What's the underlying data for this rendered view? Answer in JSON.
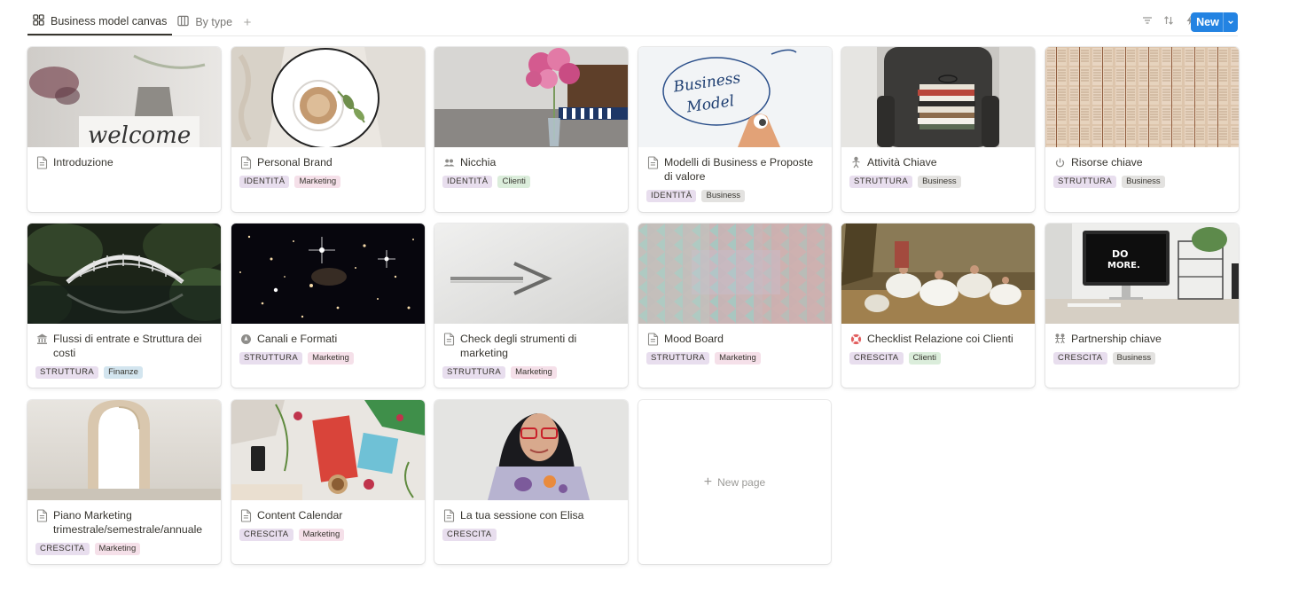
{
  "tabs": [
    {
      "label": "Business model canvas",
      "icon": "gallery-icon",
      "active": true
    },
    {
      "label": "By type",
      "icon": "table-icon",
      "active": false
    }
  ],
  "toolbar": {
    "icons": [
      "filter-icon",
      "sort-icon",
      "automation-icon",
      "search-icon",
      "more-icon"
    ],
    "new_label": "New"
  },
  "tag_colors": {
    "IDENTITÀ": "#e8deee",
    "STRUTTURA": "#e8deee",
    "CRESCITA": "#e8deee",
    "Marketing": "#f5e0e9",
    "Clienti": "#dbeddb",
    "Business": "#e3e2e0",
    "Finanze": "#d3e5ef"
  },
  "cards": [
    {
      "title": "Introduzione",
      "icon": "page-icon",
      "tags": []
    },
    {
      "title": "Personal Brand",
      "icon": "page-icon",
      "tags": [
        "IDENTITÀ",
        "Marketing"
      ]
    },
    {
      "title": "Nicchia",
      "icon": "people-icon",
      "tags": [
        "IDENTITÀ",
        "Clienti"
      ]
    },
    {
      "title": "Modelli di Business e Proposte di valore",
      "icon": "page-icon",
      "tags": [
        "IDENTITÀ",
        "Business"
      ]
    },
    {
      "title": "Attività Chiave",
      "icon": "person-icon",
      "tags": [
        "STRUTTURA",
        "Business"
      ]
    },
    {
      "title": "Risorse chiave",
      "icon": "power-icon",
      "tags": [
        "STRUTTURA",
        "Business"
      ]
    },
    {
      "title": "Flussi di entrate e Struttura dei costi",
      "icon": "bank-icon",
      "tags": [
        "STRUTTURA",
        "Finanze"
      ]
    },
    {
      "title": "Canali e Formati",
      "icon": "compass-icon",
      "tags": [
        "STRUTTURA",
        "Marketing"
      ]
    },
    {
      "title": "Check degli strumenti di marketing",
      "icon": "page-icon",
      "tags": [
        "STRUTTURA",
        "Marketing"
      ]
    },
    {
      "title": "Mood Board",
      "icon": "page-icon",
      "tags": [
        "STRUTTURA",
        "Marketing"
      ]
    },
    {
      "title": "Checklist Relazione coi Clienti",
      "icon": "lifebuoy-icon",
      "tags": [
        "CRESCITA",
        "Clienti"
      ]
    },
    {
      "title": "Partnership chiave",
      "icon": "partners-icon",
      "tags": [
        "CRESCITA",
        "Business"
      ]
    },
    {
      "title": "Piano Marketing trimestrale/semestrale/annuale",
      "icon": "page-icon",
      "tags": [
        "CRESCITA",
        "Marketing"
      ]
    },
    {
      "title": "Content Calendar",
      "icon": "page-icon",
      "tags": [
        "CRESCITA",
        "Marketing"
      ]
    },
    {
      "title": "La tua sessione con Elisa",
      "icon": "page-icon",
      "tags": [
        "CRESCITA"
      ]
    }
  ],
  "new_page_label": "New page"
}
